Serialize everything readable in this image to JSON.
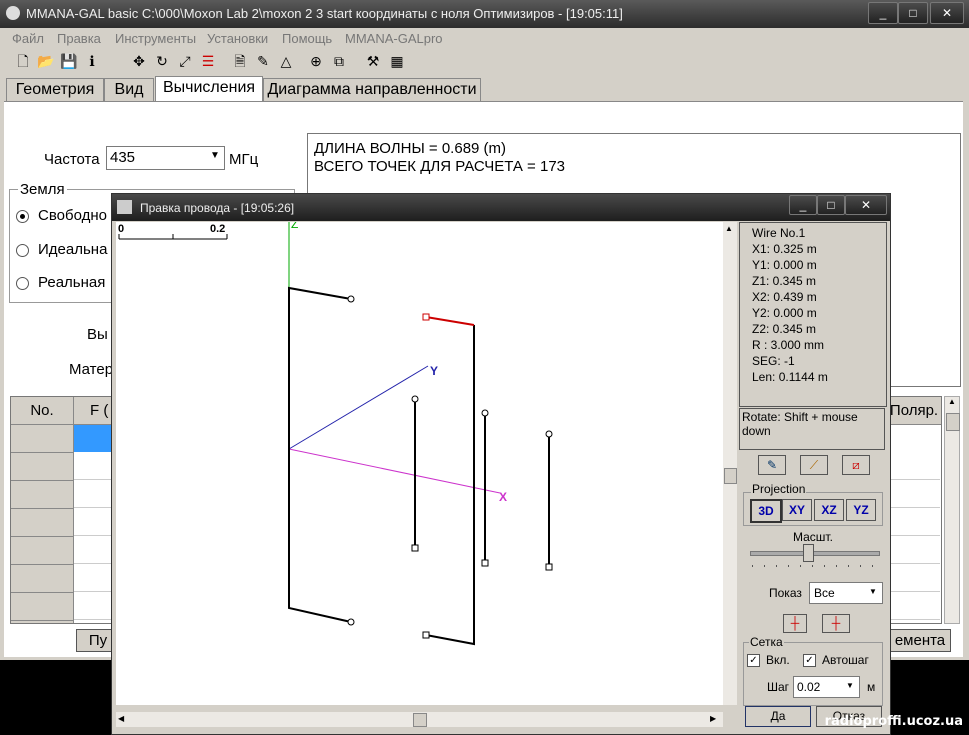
{
  "main_window": {
    "title": "MMANA-GAL basic C:\\000\\Moxon Lab 2\\moxon 2 3 start координаты с ноля Оптимизиров - [19:05:11]",
    "menu": [
      "Файл",
      "Правка",
      "Инструменты",
      "Установки",
      "Помощь",
      "MMANA-GALpro"
    ],
    "tabs": [
      "Геометрия",
      "Вид",
      "Вычисления",
      "Диаграмма направленности"
    ],
    "active_tab": "Вычисления",
    "freq_label": "Частота",
    "freq_value": "435",
    "freq_unit": "МГц",
    "ground_group": "Земля",
    "ground_options": [
      "Свободно",
      "Идеальна",
      "Реальная"
    ],
    "calc_label_1": "Вы",
    "calc_label_2": "Матер",
    "output_line_1": "ДЛИНА ВОЛНЫ = 0.689 (m)",
    "output_line_2": "ВСЕГО ТОЧЕК ДЛЯ РАСЧЕТА = 173",
    "table_headers": [
      "No.",
      "F (",
      "Поляр."
    ],
    "bottom_btn_left": "Пу",
    "bottom_btn_right": "емента"
  },
  "dialog": {
    "title": "Правка провода - [19:05:26]",
    "scale_start": "0",
    "scale_end": "0.2",
    "axis_z": "Z",
    "axis_y": "Y",
    "axis_x": "X",
    "info": [
      "Wire No.1",
      "X1: 0.325 m",
      "Y1: 0.000 m",
      "Z1: 0.345 m",
      "X2: 0.439 m",
      "Y2: 0.000 m",
      "Z2: 0.345 m",
      "R : 3.000 mm",
      "SEG: -1",
      "Len: 0.1144 m"
    ],
    "rotate_hint": "Rotate: Shift + mouse down",
    "projection_label": "Projection",
    "projection_buttons": [
      "3D",
      "XY",
      "XZ",
      "YZ"
    ],
    "scale_label": "Масшт.",
    "show_label": "Показ",
    "show_value": "Все",
    "grid_label": "Сетка",
    "grid_on_label": "Вкл.",
    "grid_auto_label": "Автошаг",
    "step_label": "Шаг",
    "step_value": "0.02",
    "step_unit": "м",
    "ok_label": "Да",
    "cancel_label": "Отказ"
  },
  "watermark": "radioproffi.ucoz.ua"
}
